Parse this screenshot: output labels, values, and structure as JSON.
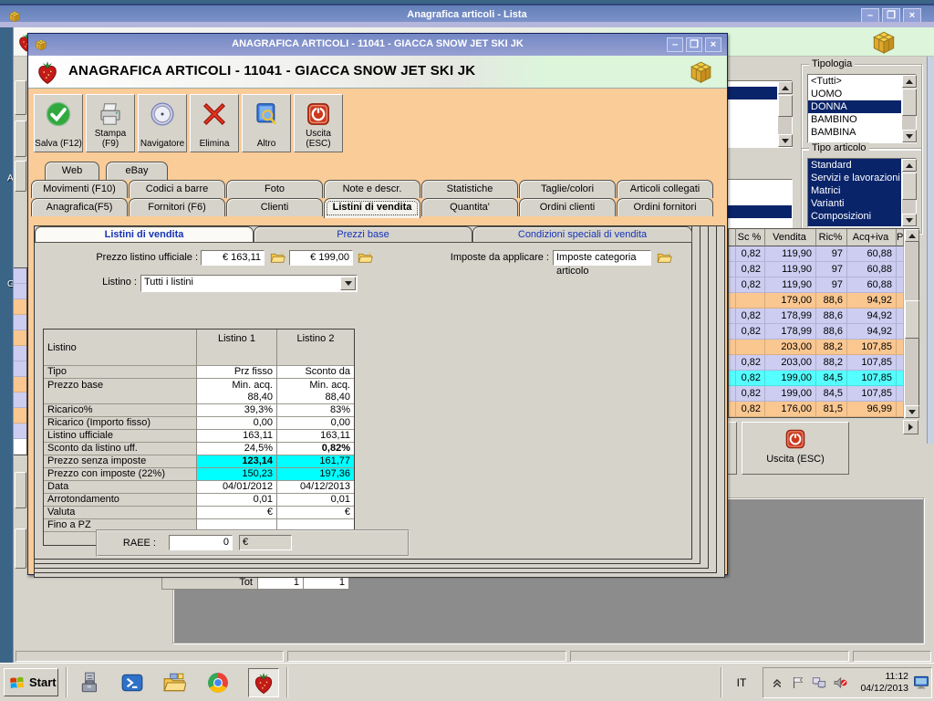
{
  "main_window": {
    "title": "Anagrafica articoli  - Lista"
  },
  "desktop": {
    "partial_icon_labels": [
      "A",
      "G"
    ]
  },
  "dialog": {
    "title": "ANAGRAFICA ARTICOLI - 11041 - GIACCA SNOW JET SKI JK",
    "header_title": "ANAGRAFICA ARTICOLI - 11041 - GIACCA SNOW JET SKI JK",
    "toolbar": [
      {
        "label": "Salva (F12)",
        "icon": "save-check"
      },
      {
        "label": "Stampa (F9)",
        "icon": "printer"
      },
      {
        "label": "Navigatore",
        "icon": "compass"
      },
      {
        "label": "Elimina",
        "icon": "delete-x"
      },
      {
        "label": "Altro",
        "icon": "book-search"
      },
      {
        "label": "Uscita (ESC)",
        "icon": "power"
      }
    ],
    "tab_rows": [
      [
        "Web",
        "eBay"
      ],
      [
        "Movimenti (F10)",
        "Codici a barre",
        "Foto",
        "Note e descr.",
        "Statistiche",
        "Taglie/colori",
        "Articoli collegati"
      ],
      [
        "Anagrafica(F5)",
        "Fornitori (F6)",
        "Clienti",
        "Listini di vendita",
        "Quantita'",
        "Ordini clienti",
        "Ordini fornitori"
      ]
    ],
    "active_tab": "Listini di vendita",
    "subtabs": [
      "Listini di vendita",
      "Prezzi base",
      "Condizioni speciali di vendita"
    ],
    "active_subtab": "Listini di vendita",
    "fields": {
      "prezzo_listino_label": "Prezzo listino ufficiale :",
      "prezzo1": "€ 163,11",
      "prezzo2": "€ 199,00",
      "imposte_label": "Imposte da applicare :",
      "imposte_value": "Imposte categoria articolo",
      "listino_label": "Listino :",
      "listino_value": "Tutti i listini",
      "raee_label": "RAEE :",
      "raee_value": "0",
      "raee_currency": "€"
    },
    "price_table": {
      "columns": [
        "Listino",
        "Listino 1",
        "Listino 2"
      ],
      "rows": [
        {
          "label": "Tipo",
          "v1": "Prz fisso",
          "v2": "Sconto da listino"
        },
        {
          "label": "Prezzo base",
          "v1": "Min. acq.\n88,40",
          "v2": "Min. acq.\n88,40",
          "tall": true
        },
        {
          "label": "Ricarico%",
          "v1": "39,3%",
          "v2": "83%"
        },
        {
          "label": "Ricarico (Importo fisso)",
          "v1": "0,00",
          "v2": "0,00"
        },
        {
          "label": "Listino ufficiale",
          "v1": "163,11",
          "v2": "163,11"
        },
        {
          "label": "Sconto da listino uff.",
          "v1": "24,5%",
          "v2": "0,82%",
          "bold2": true
        },
        {
          "label": "Prezzo senza imposte",
          "v1": "123,14",
          "v2": "161,77",
          "cyan": true,
          "bold1": true
        },
        {
          "label": "Prezzo con imposte (22%)",
          "v1": "150,23",
          "v2": "197,36",
          "cyan": true
        },
        {
          "label": "Data",
          "v1": "04/01/2012",
          "v2": "04/12/2013"
        },
        {
          "label": "Arrotondamento",
          "v1": "0,01",
          "v2": "0,01"
        },
        {
          "label": "Valuta",
          "v1": "€",
          "v2": "€"
        },
        {
          "label": "Fino a PZ",
          "v1": "",
          "v2": ""
        }
      ]
    }
  },
  "background_window": {
    "tipologia": {
      "label": "Tipologia",
      "items": [
        "<Tutti>",
        "UOMO",
        "DONNA",
        "BAMBINO",
        "BAMBINA"
      ],
      "selected": "DONNA"
    },
    "tipo_articolo": {
      "label": "Tipo articolo",
      "items": [
        "Standard",
        "Servizi e lavorazioni",
        "Matrici",
        "Varianti",
        "Composizioni"
      ]
    },
    "grid": {
      "columns": [
        "",
        "Sc %",
        "Vendita",
        "Ric%",
        "Acq+iva",
        "P"
      ],
      "rows": [
        {
          "bg": "lavender",
          "cells": [
            "0,82",
            "119,90",
            "97",
            "60,88"
          ]
        },
        {
          "bg": "lavender",
          "cells": [
            "0,82",
            "119,90",
            "97",
            "60,88"
          ]
        },
        {
          "bg": "lavender",
          "cells": [
            "0,82",
            "119,90",
            "97",
            "60,88"
          ]
        },
        {
          "bg": "orange",
          "cells": [
            "",
            "179,00",
            "88,6",
            "94,92"
          ]
        },
        {
          "bg": "lavender",
          "cells": [
            "0,82",
            "178,99",
            "88,6",
            "94,92"
          ]
        },
        {
          "bg": "lavender",
          "cells": [
            "0,82",
            "178,99",
            "88,6",
            "94,92"
          ]
        },
        {
          "bg": "orange",
          "cells": [
            "",
            "203,00",
            "88,2",
            "107,85"
          ]
        },
        {
          "bg": "lavender",
          "cells": [
            "0,82",
            "203,00",
            "88,2",
            "107,85"
          ]
        },
        {
          "bg": "cyan",
          "cells": [
            "0,82",
            "199,00",
            "84,5",
            "107,85"
          ]
        },
        {
          "bg": "lavender",
          "cells": [
            "0,82",
            "199,00",
            "84,5",
            "107,85"
          ]
        },
        {
          "bg": "orange",
          "cells": [
            "0,82",
            "176,00",
            "81,5",
            "96,99"
          ]
        }
      ]
    },
    "uscita_label": "Uscita (ESC)",
    "tot": {
      "label": "Tot",
      "values": [
        "1",
        "1"
      ]
    },
    "sliver_row_pattern": [
      "lavender",
      "lavender",
      "orange",
      "lavender",
      "orange",
      "lavender",
      "lavender",
      "orange",
      "lavender",
      "orange",
      "lavender",
      "white"
    ]
  },
  "taskbar": {
    "start_label": "Start",
    "quick_launch": [
      {
        "name": "system-tools"
      },
      {
        "name": "powershell"
      },
      {
        "name": "file-explorer"
      },
      {
        "name": "chrome"
      },
      {
        "name": "strawberry-app",
        "active": true
      }
    ],
    "language": "IT",
    "tray_icons": [
      "chevron-up",
      "flag",
      "network",
      "speaker-mute"
    ],
    "time": "11:12",
    "date": "04/12/2013"
  },
  "colors": {
    "peach": "#FACC98",
    "cyan_cell": "#00FFFF",
    "row_lavender": "#CDCDF2",
    "row_orange": "#FAC791",
    "row_selected": "#55FFFF",
    "navy": "#0A246A",
    "green_strip": "#DCF5DB"
  }
}
